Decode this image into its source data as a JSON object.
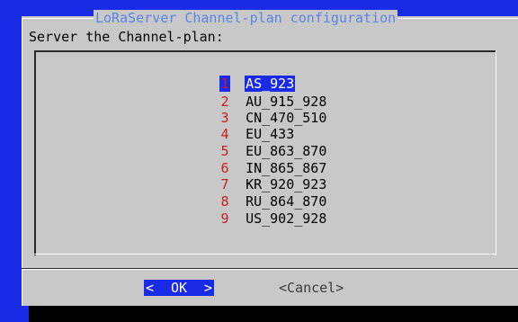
{
  "dialog": {
    "title": "LoRaServer Channel-plan configuration",
    "prompt": "Server the Channel-plan:"
  },
  "list": {
    "items": [
      {
        "num": "1",
        "label": "AS_923",
        "selected": true
      },
      {
        "num": "2",
        "label": "AU_915_928",
        "selected": false
      },
      {
        "num": "3",
        "label": "CN_470_510",
        "selected": false
      },
      {
        "num": "4",
        "label": "EU_433",
        "selected": false
      },
      {
        "num": "5",
        "label": "EU_863_870",
        "selected": false
      },
      {
        "num": "6",
        "label": "IN_865_867",
        "selected": false
      },
      {
        "num": "7",
        "label": "KR_920_923",
        "selected": false
      },
      {
        "num": "8",
        "label": "RU_864_870",
        "selected": false
      },
      {
        "num": "9",
        "label": "US_902_928",
        "selected": false
      }
    ]
  },
  "buttons": {
    "ok_left": "<",
    "ok_label": "OK",
    "ok_right": ">",
    "cancel_label": "<Cancel>"
  },
  "colors": {
    "background": "#1a2be8",
    "dialog": "#c8c8c8",
    "title": "#5a85e6",
    "hotkey": "#c81e1e",
    "selection": "#1a2be8"
  }
}
